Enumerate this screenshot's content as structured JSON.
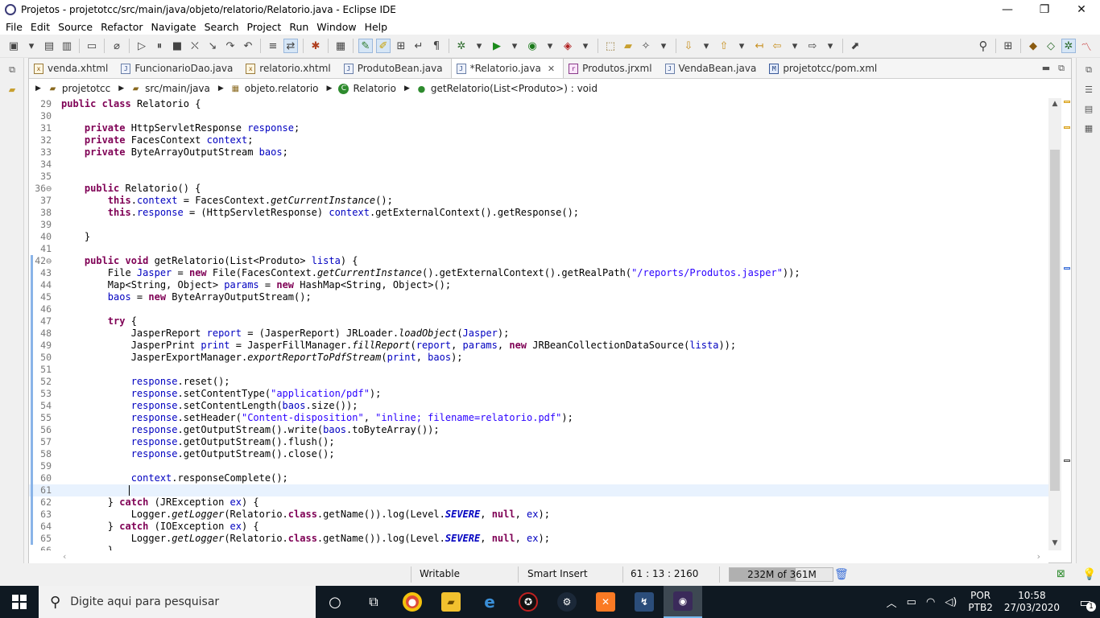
{
  "window": {
    "title": "Projetos - projetotcc/src/main/java/objeto/relatorio/Relatorio.java - Eclipse IDE",
    "minimize": "—",
    "maximize": "❐",
    "close": "✕"
  },
  "menu": [
    "File",
    "Edit",
    "Source",
    "Refactor",
    "Navigate",
    "Search",
    "Project",
    "Run",
    "Window",
    "Help"
  ],
  "tabs": [
    {
      "label": "venda.xhtml",
      "icon": "xml"
    },
    {
      "label": "FuncionarioDao.java",
      "icon": "java"
    },
    {
      "label": "relatorio.xhtml",
      "icon": "xml"
    },
    {
      "label": "ProdutoBean.java",
      "icon": "java"
    },
    {
      "label": "*Relatorio.java",
      "icon": "java",
      "active": true
    },
    {
      "label": "Produtos.jrxml",
      "icon": "jr"
    },
    {
      "label": "VendaBean.java",
      "icon": "java"
    },
    {
      "label": "projetotcc/pom.xml",
      "icon": "mvn"
    }
  ],
  "breadcrumb": [
    "projetotcc",
    "src/main/java",
    "objeto.relatorio",
    "Relatorio",
    "getRelatorio(List<Produto>) : void"
  ],
  "code": {
    "current_line": "61",
    "lines": [
      {
        "n": "29",
        "t": "public class Relatorio {"
      },
      {
        "n": "30",
        "t": ""
      },
      {
        "n": "31",
        "t": "    private HttpServletResponse response;"
      },
      {
        "n": "32",
        "t": "    private FacesContext context;"
      },
      {
        "n": "33",
        "t": "    private ByteArrayOutputStream baos;"
      },
      {
        "n": "34",
        "t": ""
      },
      {
        "n": "35",
        "t": ""
      },
      {
        "n": "36⊖",
        "t": "    public Relatorio() {"
      },
      {
        "n": "37",
        "t": "        this.context = FacesContext.getCurrentInstance();"
      },
      {
        "n": "38",
        "t": "        this.response = (HttpServletResponse) context.getExternalContext().getResponse();"
      },
      {
        "n": "39",
        "t": ""
      },
      {
        "n": "40",
        "t": "    }"
      },
      {
        "n": "41",
        "t": ""
      },
      {
        "n": "42⊖",
        "t": "    public void getRelatorio(List<Produto> lista) {"
      },
      {
        "n": "43",
        "t": "        File Jasper = new File(FacesContext.getCurrentInstance().getExternalContext().getRealPath(\"/reports/Produtos.jasper\"));"
      },
      {
        "n": "44",
        "t": "        Map<String, Object> params = new HashMap<String, Object>();"
      },
      {
        "n": "45",
        "t": "        baos = new ByteArrayOutputStream();"
      },
      {
        "n": "46",
        "t": ""
      },
      {
        "n": "47",
        "t": "        try {"
      },
      {
        "n": "48",
        "t": "            JasperReport report = (JasperReport) JRLoader.loadObject(Jasper);"
      },
      {
        "n": "49",
        "t": "            JasperPrint print = JasperFillManager.fillReport(report, params, new JRBeanCollectionDataSource(lista));"
      },
      {
        "n": "50",
        "t": "            JasperExportManager.exportReportToPdfStream(print, baos);"
      },
      {
        "n": "51",
        "t": ""
      },
      {
        "n": "52",
        "t": "            response.reset();"
      },
      {
        "n": "53",
        "t": "            response.setContentType(\"application/pdf\");"
      },
      {
        "n": "54",
        "t": "            response.setContentLength(baos.size());"
      },
      {
        "n": "55",
        "t": "            response.setHeader(\"Content-disposition\", \"inline; filename=relatorio.pdf\");"
      },
      {
        "n": "56",
        "t": "            response.getOutputStream().write(baos.toByteArray());"
      },
      {
        "n": "57",
        "t": "            response.getOutputStream().flush();"
      },
      {
        "n": "58",
        "t": "            response.getOutputStream().close();"
      },
      {
        "n": "59",
        "t": ""
      },
      {
        "n": "60",
        "t": "            context.responseComplete();"
      },
      {
        "n": "61",
        "t": "            "
      },
      {
        "n": "62",
        "t": "        } catch (JRException ex) {"
      },
      {
        "n": "63",
        "t": "            Logger.getLogger(Relatorio.class.getName()).log(Level.SEVERE, null, ex);"
      },
      {
        "n": "64",
        "t": "        } catch (IOException ex) {"
      },
      {
        "n": "65",
        "t": "            Logger.getLogger(Relatorio.class.getName()).log(Level.SEVERE, null, ex);"
      },
      {
        "n": "66",
        "t": "        }"
      }
    ]
  },
  "status": {
    "writable": "Writable",
    "insert_mode": "Smart Insert",
    "position": "61 : 13 : 2160",
    "heap": "232M of 361M",
    "heap_used_fraction": 0.64
  },
  "taskbar": {
    "search_placeholder": "Digite aqui para pesquisar",
    "lang_top": "POR",
    "lang_bottom": "PTB2",
    "time": "10:58",
    "date": "27/03/2020",
    "notifications": "1"
  }
}
